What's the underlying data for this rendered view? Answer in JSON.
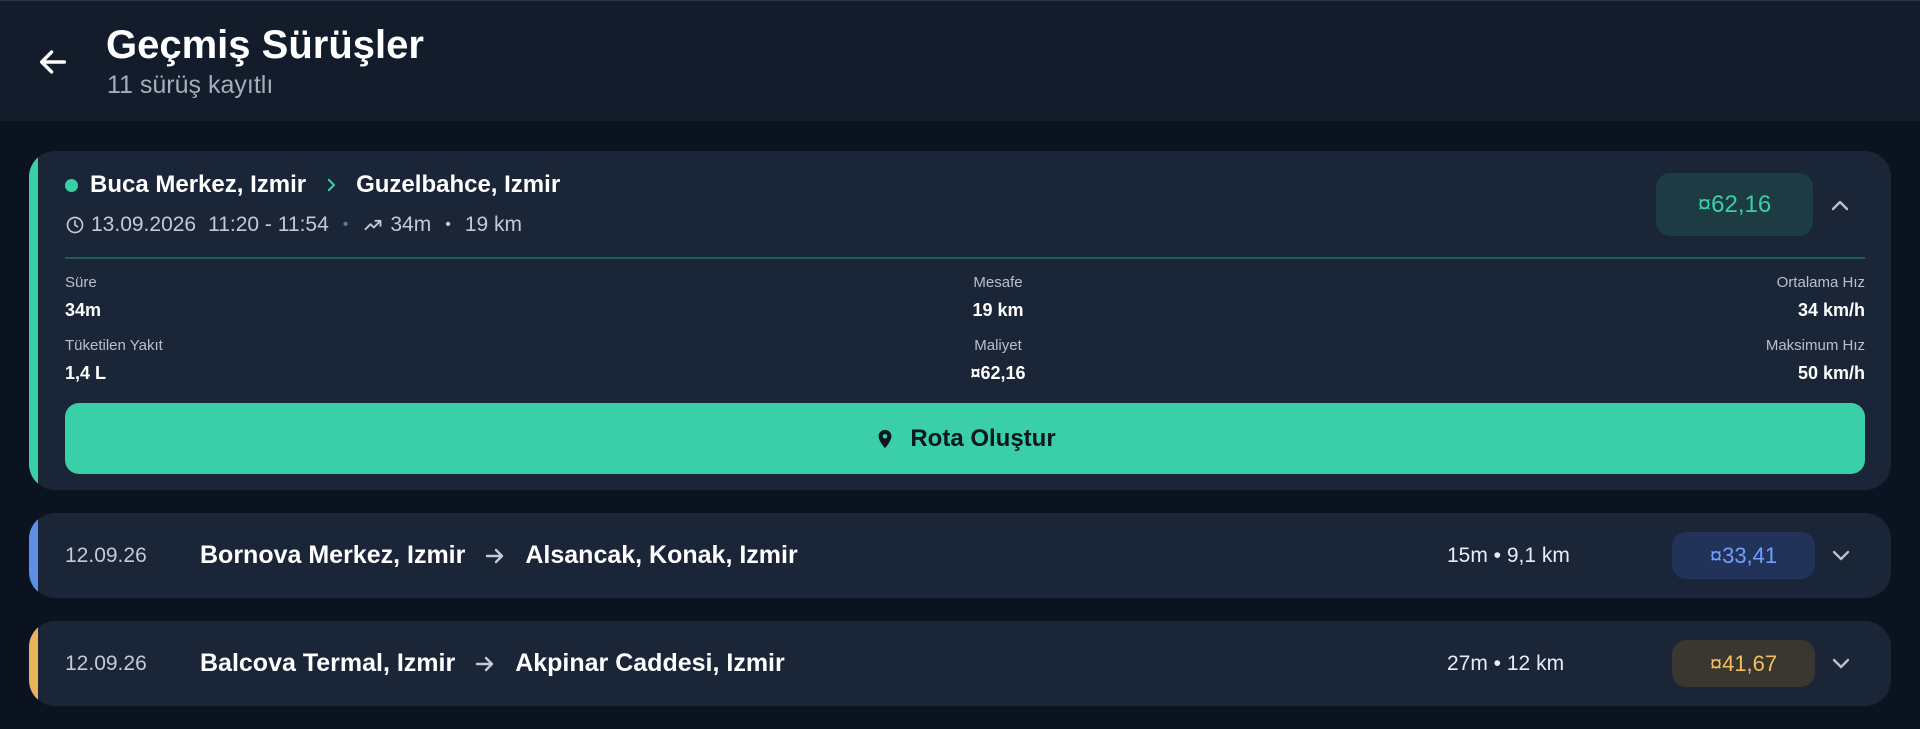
{
  "header": {
    "title": "Geçmiş Sürüşler",
    "subtitle": "11 sürüş kayıtlı"
  },
  "colors": {
    "green": "#3acfa6",
    "blue": "#5b8fe8",
    "amber": "#e8b45b",
    "card": "#1a2537",
    "background": "#0b1220"
  },
  "trips": [
    {
      "origin": "Buca Merkez, Izmir",
      "destination": "Guzelbahce, Izmir",
      "date": "13.09.2026",
      "time": "11:20 - 11:54",
      "duration": "34m",
      "distance": "19 km",
      "price": "¤62,16",
      "details": {
        "duration_label": "Süre",
        "duration_value": "34m",
        "distance_label": "Mesafe",
        "distance_value": "19 km",
        "avg_speed_label": "Ortalama Hız",
        "avg_speed_value": "34 km/h",
        "fuel_label": "Tüketilen Yakıt",
        "fuel_value": "1,4 L",
        "cost_label": "Maliyet",
        "cost_value": "¤62,16",
        "max_speed_label": "Maksimum Hız",
        "max_speed_value": "50 km/h"
      },
      "cta_label": "Rota Oluştur"
    },
    {
      "date": "12.09.26",
      "origin": "Bornova Merkez, Izmir",
      "destination": "Alsancak, Konak, Izmir",
      "stats": "15m • 9,1 km",
      "price": "¤33,41"
    },
    {
      "date": "12.09.26",
      "origin": "Balcova Termal, Izmir",
      "destination": "Akpinar Caddesi, Izmir",
      "stats": "27m • 12 km",
      "price": "¤41,67"
    }
  ]
}
